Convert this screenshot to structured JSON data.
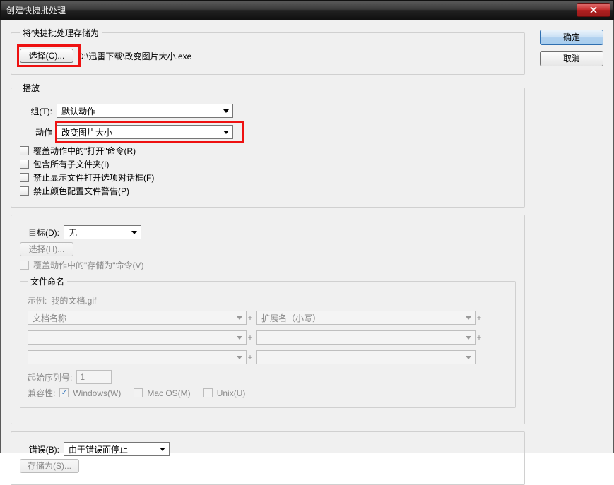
{
  "window": {
    "title": "创建快捷批处理"
  },
  "buttons": {
    "ok": "确定",
    "cancel": "取消"
  },
  "save_section": {
    "legend": "将快捷批处理存储为",
    "choose_btn": "选择(C)...",
    "path": "D:\\迅雷下载\\改变图片大小.exe"
  },
  "play_section": {
    "legend": "播放",
    "group_label": "组(T):",
    "group_value": "默认动作",
    "action_label": "动作",
    "action_value": "改变图片大小",
    "cb_override_open": "覆盖动作中的\"打开\"命令(R)",
    "cb_include_sub": "包含所有子文件夹(I)",
    "cb_suppress_open": "禁止显示文件打开选项对话框(F)",
    "cb_suppress_color": "禁止颜色配置文件警告(P)"
  },
  "target_section": {
    "target_label": "目标(D):",
    "target_value": "无",
    "choose_btn": "选择(H)...",
    "cb_override_save": "覆盖动作中的\"存储为\"命令(V)"
  },
  "naming": {
    "legend": "文件命名",
    "example_label": "示例:",
    "example_value": "我的文档.gif",
    "field1": "文档名称",
    "field2": "扩展名（小写）",
    "start_serial_label": "起始序列号:",
    "start_serial_value": "1",
    "compat_label": "兼容性:",
    "compat_win": "Windows(W)",
    "compat_mac": "Mac OS(M)",
    "compat_unix": "Unix(U)"
  },
  "error_section": {
    "label": "错误(B):",
    "value": "由于错误而停止",
    "save_as_btn": "存储为(S)..."
  }
}
